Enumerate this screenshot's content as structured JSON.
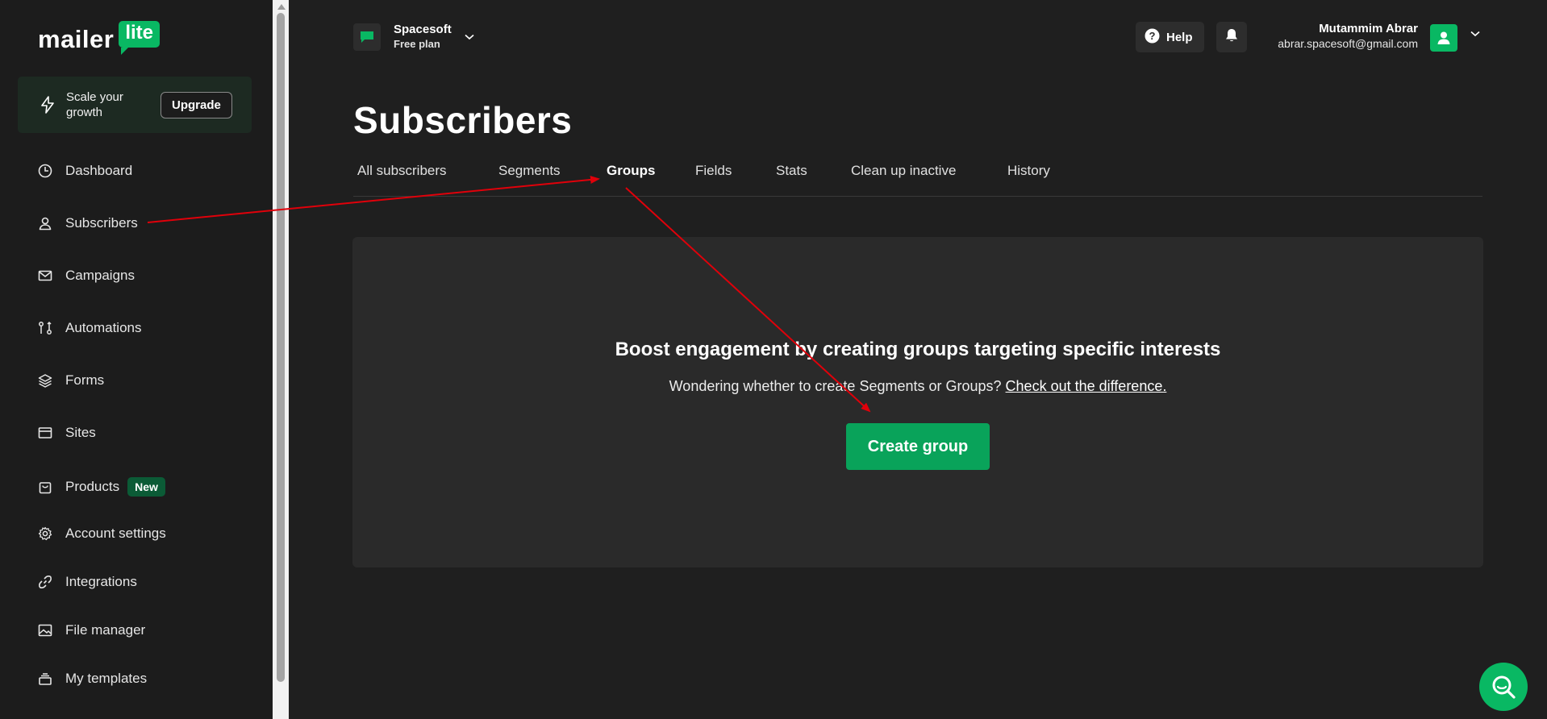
{
  "brand": {
    "logo_text": "mailer",
    "logo_badge": "lite"
  },
  "upgrade": {
    "text": "Scale your growth",
    "button": "Upgrade"
  },
  "sidebar": {
    "items": [
      {
        "label": "Dashboard",
        "icon": "clock-icon"
      },
      {
        "label": "Subscribers",
        "icon": "user-icon"
      },
      {
        "label": "Campaigns",
        "icon": "mail-icon"
      },
      {
        "label": "Automations",
        "icon": "workflow-icon"
      },
      {
        "label": "Forms",
        "icon": "layers-icon"
      },
      {
        "label": "Sites",
        "icon": "browser-icon"
      },
      {
        "label": "Products",
        "icon": "bag-icon",
        "badge": "New"
      },
      {
        "label": "Account settings",
        "icon": "gear-icon"
      },
      {
        "label": "Integrations",
        "icon": "link-icon"
      },
      {
        "label": "File manager",
        "icon": "image-icon"
      },
      {
        "label": "My templates",
        "icon": "stack-icon"
      }
    ]
  },
  "account": {
    "name": "Spacesoft",
    "plan": "Free plan"
  },
  "header": {
    "help_label": "Help"
  },
  "user": {
    "name": "Mutammim Abrar",
    "email": "abrar.spacesoft@gmail.com"
  },
  "page": {
    "title": "Subscribers"
  },
  "tabs": [
    {
      "label": "All subscribers",
      "active": false
    },
    {
      "label": "Segments",
      "active": false
    },
    {
      "label": "Groups",
      "active": true
    },
    {
      "label": "Fields",
      "active": false
    },
    {
      "label": "Stats",
      "active": false
    },
    {
      "label": "Clean up inactive",
      "active": false
    },
    {
      "label": "History",
      "active": false
    }
  ],
  "empty_state": {
    "title": "Boost engagement by creating groups targeting specific interests",
    "subtitle": "Wondering whether to create Segments or Groups?",
    "link": "Check out the difference.",
    "button": "Create group"
  },
  "colors": {
    "brand_green": "#09b863",
    "button_green": "#09a35a",
    "annotation_red": "#e0000a"
  }
}
